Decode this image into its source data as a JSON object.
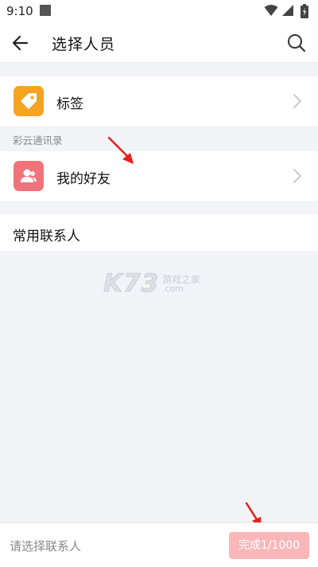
{
  "status_bar": {
    "time": "9:10"
  },
  "app_bar": {
    "title": "选择人员"
  },
  "rows": {
    "tags_label": "标签",
    "section_label": "彩云通讯录",
    "friends_label": "我的好友",
    "frequent_label": "常用联系人"
  },
  "watermark": {
    "main": "K73",
    "sub1": "游戏之家",
    "sub2": ".com"
  },
  "bottom_bar": {
    "placeholder": "请选择联系人",
    "done_label": "完成1/1000"
  },
  "colors": {
    "tag_icon_bg": "#f5a323",
    "friends_icon_bg": "#f0727a",
    "done_button_bg": "#f9b7b9",
    "annotation_arrow": "#e8201b"
  },
  "icons": {
    "status_icons": [
      "wifi-icon",
      "signal-icon",
      "battery-icon"
    ],
    "app_bar": [
      "back-arrow-icon",
      "search-icon"
    ],
    "rows": [
      "tag-icon",
      "friends-icon",
      "chevron-right-icon"
    ]
  }
}
